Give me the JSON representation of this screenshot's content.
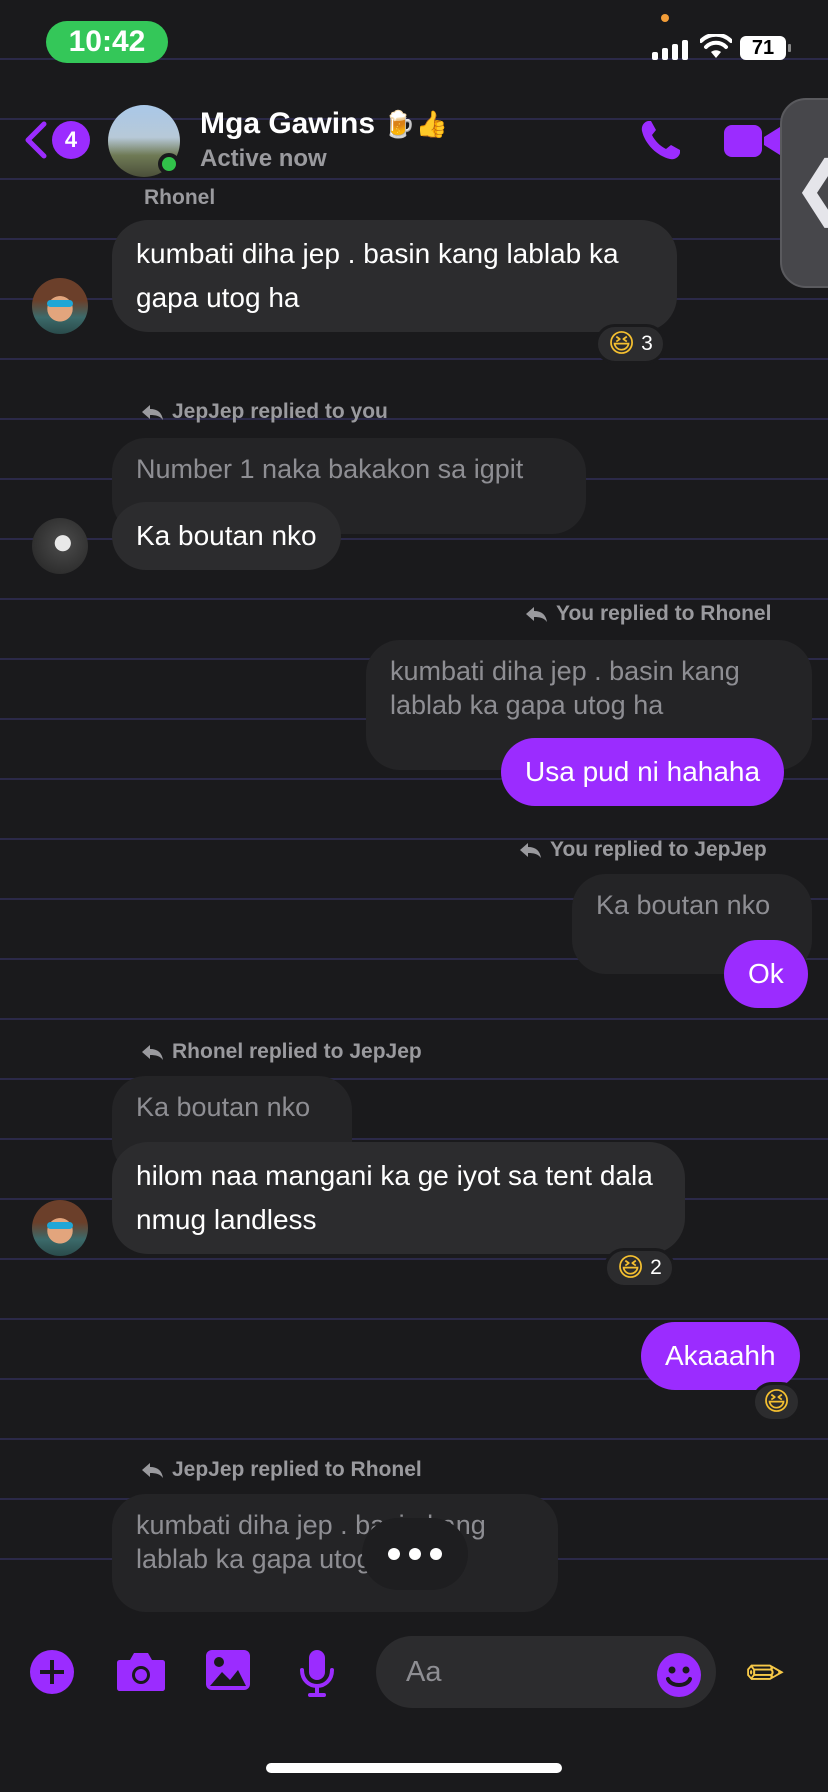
{
  "status": {
    "time": "10:42",
    "battery": "71"
  },
  "header": {
    "back_count": "4",
    "title": "Mga Gawins",
    "title_emoji": "🍺👍",
    "subtitle": "Active now"
  },
  "messages": {
    "m1": {
      "sender": "Rhonel",
      "text": "kumbati diha jep . basin kang lablab ka gapa utog ha",
      "reaction_count": "3"
    },
    "m2": {
      "reply_label": "JepJep replied to you",
      "quote": "Number 1 naka bakakon sa igpit",
      "text": "Ka boutan nko"
    },
    "m3": {
      "reply_label": "You replied to Rhonel",
      "quote": "kumbati diha jep . basin kang lablab ka gapa utog ha",
      "text": "Usa pud ni hahaha"
    },
    "m4": {
      "reply_label": "You replied to JepJep",
      "quote": "Ka boutan nko",
      "text": "Ok"
    },
    "m5": {
      "reply_label": "Rhonel replied to JepJep",
      "quote": "Ka boutan nko",
      "text": "hilom naa mangani ka ge iyot sa tent dala nmug landless",
      "reaction_count": "2"
    },
    "m6": {
      "text": "Akaaahh"
    },
    "m7": {
      "reply_label": "JepJep replied to Rhonel",
      "quote": "kumbati diha jep . basin kang lablab ka gapa utog ha"
    }
  },
  "composer": {
    "placeholder": "Aa"
  },
  "colors": {
    "accent": "#9b2cff",
    "bubble_other": "#2c2c2e",
    "background": "#1a1a1c",
    "online": "#31c24a"
  },
  "icons": [
    "back-chevron-icon",
    "phone-icon",
    "video-camera-icon",
    "reply-arrow-icon",
    "laughing-emoji-icon",
    "plus-icon",
    "camera-icon",
    "image-icon",
    "microphone-icon",
    "smile-emoji-icon",
    "pencil-icon"
  ]
}
